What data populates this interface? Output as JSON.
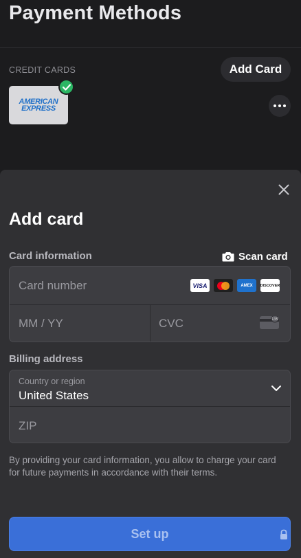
{
  "page": {
    "title": "Payment Methods",
    "section_label": "CREDIT CARDS",
    "add_card_label": "Add Card",
    "saved_card": {
      "brand_line1": "AMERICAN",
      "brand_line2": "EXPRESS",
      "selected_icon": "check-circle-icon",
      "more_icon": "more-horizontal-icon"
    }
  },
  "sheet": {
    "close_icon": "close-icon",
    "title": "Add card",
    "card_info_label": "Card information",
    "scan_card_label": "Scan card",
    "scan_icon": "camera-icon",
    "card_number_placeholder": "Card number",
    "expiry_placeholder": "MM / YY",
    "cvc_placeholder": "CVC",
    "brands": {
      "visa": "VISA",
      "amex": "AMEX",
      "discover": "DISCOVER"
    },
    "billing_label": "Billing address",
    "country_label": "Country or region",
    "country_value": "United States",
    "zip_placeholder": "ZIP",
    "terms": "By providing your card information, you allow  to charge your card for future payments in accordance with their terms.",
    "setup_label": "Set up",
    "lock_icon": "lock-icon"
  },
  "colors": {
    "background": "#1c1c1e",
    "sheet": "#303033",
    "field": "#3d3d41",
    "primary": "#3a6fd8",
    "success": "#2bb664",
    "amex_blue": "#1f72cd"
  }
}
